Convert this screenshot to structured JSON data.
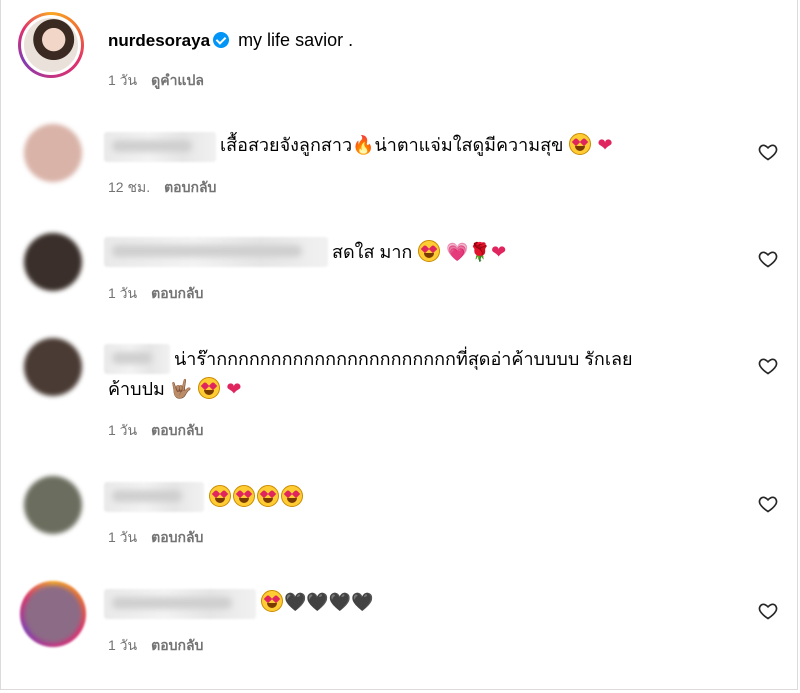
{
  "post": {
    "username": "nurdesoraya",
    "caption": "my life savior .",
    "time": "1 วัน",
    "translate": "ดูคำแปล"
  },
  "reply_label": "ตอบกลับ",
  "comments": [
    {
      "text": "เสื้อสวยจังลูกสาว🔥น่าตาแจ่มใสดูมีความสุข",
      "time": "12 ชม.",
      "avatar_color": "#d9b3a8"
    },
    {
      "text": "สดใส มาก",
      "time": "1 วัน",
      "avatar_color": "#3a2f2a"
    },
    {
      "text": "น่าร๊ากกกกกกกกกกกกกกกกกกกกกกที่สุดอ่าค้าบบบบ รักเลย",
      "text2": "ค้าบปม",
      "time": "1 วัน",
      "avatar_color": "#4a3b34"
    },
    {
      "text": "",
      "time": "1 วัน",
      "avatar_color": "#6b6e5f"
    },
    {
      "text": "",
      "time": "1 วัน",
      "avatar_color": "#8c6b86"
    }
  ]
}
